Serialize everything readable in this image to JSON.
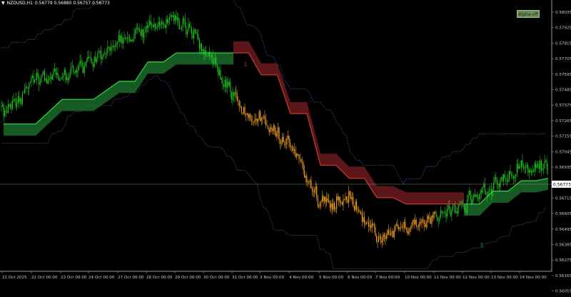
{
  "header": {
    "symbol": "NZDUSD,H1",
    "ohlc": "0.56779 0.56880 0.56757 0.56773"
  },
  "alpha_button": {
    "label": "Alpha-off"
  },
  "price_axis": {
    "labels": [
      "0.58035",
      "0.57925",
      "0.57815",
      "0.57705",
      "0.57595",
      "0.57485",
      "0.57375",
      "0.57265",
      "0.57155",
      "0.57045",
      "0.56935",
      "0.56825",
      "0.56715",
      "0.56605",
      "0.56495",
      "0.56385",
      "0.56275",
      "0.56165",
      "0.56055"
    ],
    "current_price": "0.56773"
  },
  "time_axis": {
    "labels": [
      "21 Oct 2025",
      "22 Oct 00:00",
      "23 Oct 00:00",
      "24 Oct 00:00",
      "27 Oct 00:00",
      "28 Oct 00:00",
      "29 Oct 00:00",
      "30 Oct 00:00",
      "31 Oct 00:00",
      "3 Nov 00:00",
      "4 Nov 00:00",
      "5 Nov 00:00",
      "6 Nov 00:00",
      "7 Nov 00:00",
      "10 Nov 00:00",
      "11 Nov 00:00",
      "12 Nov 00:00",
      "13 Nov 00:00",
      "14 Nov 00:00"
    ]
  },
  "markers": {
    "sell_arrow": "⇩",
    "buy_arrow": "⇧"
  },
  "colors": {
    "background": "#000000",
    "bull_candles": "#22c322",
    "bear_candles": "#f0a020",
    "trend_up": "#2ecc40",
    "trend_down": "#c0392b",
    "band_upper": "#3d6fbf",
    "band_lower": "#2a2a50",
    "axis_text": "#c8c8c8"
  },
  "chart_data": {
    "type": "candlestick",
    "symbol": "NZDUSD",
    "timeframe": "H1",
    "ylim": [
      0.5599,
      0.5808
    ],
    "last_price": 0.56773,
    "price_path_key": [
      [
        "21 Oct 2025",
        0.572
      ],
      [
        "22 Oct 00:00",
        0.5745
      ],
      [
        "23 Oct 00:00",
        0.575
      ],
      [
        "24 Oct 00:00",
        0.576
      ],
      [
        "27 Oct 00:00",
        0.5775
      ],
      [
        "28 Oct 00:00",
        0.5785
      ],
      [
        "29 Oct 00:00",
        0.5795
      ],
      [
        "30 Oct 00:00",
        0.577
      ],
      [
        "31 Oct 00:00",
        0.573
      ],
      [
        "3 Nov 00:00",
        0.5715
      ],
      [
        "4 Nov 00:00",
        0.5695
      ],
      [
        "5 Nov 00:00",
        0.565
      ],
      [
        "6 Nov 00:00",
        0.5655
      ],
      [
        "7 Nov 00:00",
        0.5625
      ],
      [
        "10 Nov 00:00",
        0.563
      ],
      [
        "11 Nov 00:00",
        0.564
      ],
      [
        "12 Nov 00:00",
        0.565
      ],
      [
        "13 Nov 00:00",
        0.5665
      ],
      [
        "14 Nov 00:00",
        0.568
      ]
    ],
    "trend_line": [
      [
        "21 Oct 2025",
        0.5712,
        "up"
      ],
      [
        "23 Oct 00:00",
        0.5731,
        "up"
      ],
      [
        "27 Oct 00:00",
        0.5745,
        "up"
      ],
      [
        "28 Oct 00:00",
        0.576,
        "up"
      ],
      [
        "29 Oct 00:00",
        0.5767,
        "up"
      ],
      [
        "31 Oct 00:00",
        0.5767,
        "down"
      ],
      [
        "3 Nov 00:00",
        0.575,
        "down"
      ],
      [
        "4 Nov 00:00",
        0.572,
        "down"
      ],
      [
        "5 Nov 00:00",
        0.568,
        "down"
      ],
      [
        "6 Nov 00:00",
        0.567,
        "down"
      ],
      [
        "7 Nov 00:00",
        0.5655,
        "down"
      ],
      [
        "10 Nov 00:00",
        0.565,
        "down"
      ],
      [
        "12 Nov 00:00",
        0.565,
        "up"
      ],
      [
        "13 Nov 00:00",
        0.566,
        "up"
      ],
      [
        "14 Nov 00:00",
        0.5668,
        "up"
      ]
    ]
  }
}
